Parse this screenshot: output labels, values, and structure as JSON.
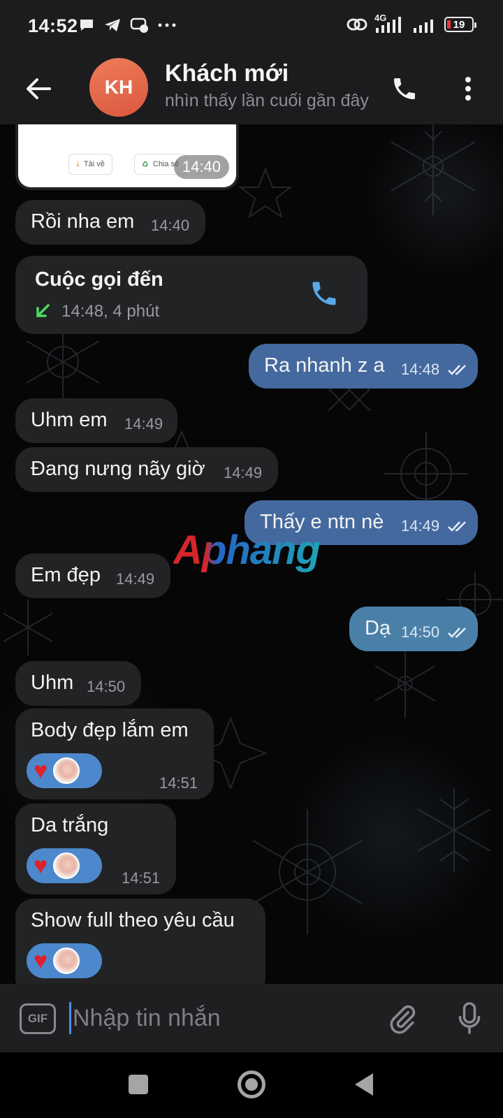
{
  "status_bar": {
    "time": "14:52",
    "network": "4G",
    "battery": "19"
  },
  "header": {
    "avatar_initials": "KH",
    "title": "Khách mới",
    "subtitle": "nhìn thấy lần cuối gần đây"
  },
  "image_message": {
    "download_label": "Tải về",
    "share_label": "Chia sẻ",
    "time": "14:40"
  },
  "messages": [
    {
      "text": "Rồi nha em",
      "time": "14:40"
    },
    {
      "text": "Ra nhanh z a",
      "time": "14:48"
    },
    {
      "text": "Uhm em",
      "time": "14:49"
    },
    {
      "text": "Đang nưng nãy giờ",
      "time": "14:49"
    },
    {
      "text": "Thấy e ntn nè",
      "time": "14:49"
    },
    {
      "text": "Em đẹp",
      "time": "14:49"
    },
    {
      "text": "Dạ",
      "time": "14:50"
    },
    {
      "text": "Uhm",
      "time": "14:50"
    },
    {
      "text": "Body đẹp lắm em",
      "time": "14:51"
    },
    {
      "text": "Da trắng",
      "time": "14:51"
    },
    {
      "text": "Show full theo yêu cầu",
      "time": ""
    }
  ],
  "call": {
    "title": "Cuộc gọi đến",
    "detail": "14:48, 4 phút"
  },
  "watermark": "Aphang",
  "composer": {
    "placeholder": "Nhập tin nhắn",
    "gif_label": "GIF"
  },
  "colors": {
    "incoming_bubble": "#222325",
    "outgoing_bubble": "#44699f",
    "accent": "#4a90e2",
    "reaction_bg": "#4d88cc"
  }
}
